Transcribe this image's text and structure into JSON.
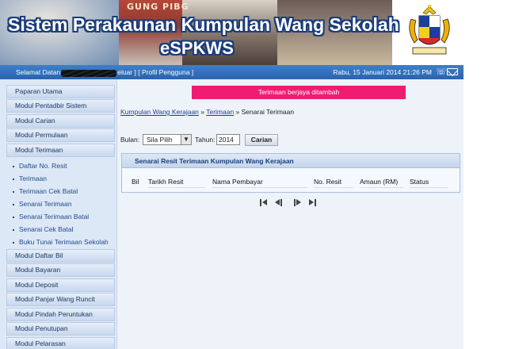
{
  "header": {
    "sign_text": "GUNG PIBG",
    "title_line1": "Sistem Perakaunan Kumpulan Wang Sekolah",
    "title_line2": "eSPKWS"
  },
  "statusbar": {
    "greeting_prefix": "Selamat Datan",
    "greeting_suffix": "eluar ] [ Profil Pengguna ]",
    "datetime": "Rabu, 15 Januari 2014 21:26 PM",
    "icons": [
      "phone-icon",
      "mail-icon"
    ]
  },
  "sidebar": {
    "menus": [
      "Paparan Utama",
      "Modul Pentadbir Sistem",
      "Modul Carian",
      "Modul Permulaan",
      "Modul Terimaan"
    ],
    "subitems": [
      "Daftar No. Resit",
      "Terimaan",
      "Terimaan Cek Batal",
      "Senarai Terimaan",
      "Senarai Terimaan Batal",
      "Senarai Cek Batal",
      "Buku Tunai Terimaan Sekolah"
    ],
    "menus_after": [
      "Modul Daftar Bil",
      "Modul Bayaran",
      "Modul Deposit",
      "Modul Panjar Wang Runcit",
      "Modul Pindah Peruntukan",
      "Modul Penutupan",
      "Modul Pelarasan"
    ]
  },
  "main": {
    "success_message": "Terimaan berjaya ditambah",
    "breadcrumb": {
      "link1": "Kumpulan Wang Kerajaan",
      "sep": " » ",
      "link2": "Terimaan",
      "current": "Senarai Terimaan"
    },
    "filter": {
      "month_label": "Bulan:",
      "month_value": "Sila Pilih",
      "year_label": "Tahun:",
      "year_value": "2014",
      "search_button": "Carian"
    },
    "panel": {
      "title": "Senarai Resit Terimaan Kumpulan Wang Kerajaan",
      "columns": [
        "Bil",
        "Tarikh Resit",
        "Nama Pembayar",
        "No. Resit",
        "Amaun (RM)",
        "Status"
      ]
    }
  },
  "colors": {
    "accent_blue": "#2a63ad",
    "success_pink": "#f01c72"
  }
}
